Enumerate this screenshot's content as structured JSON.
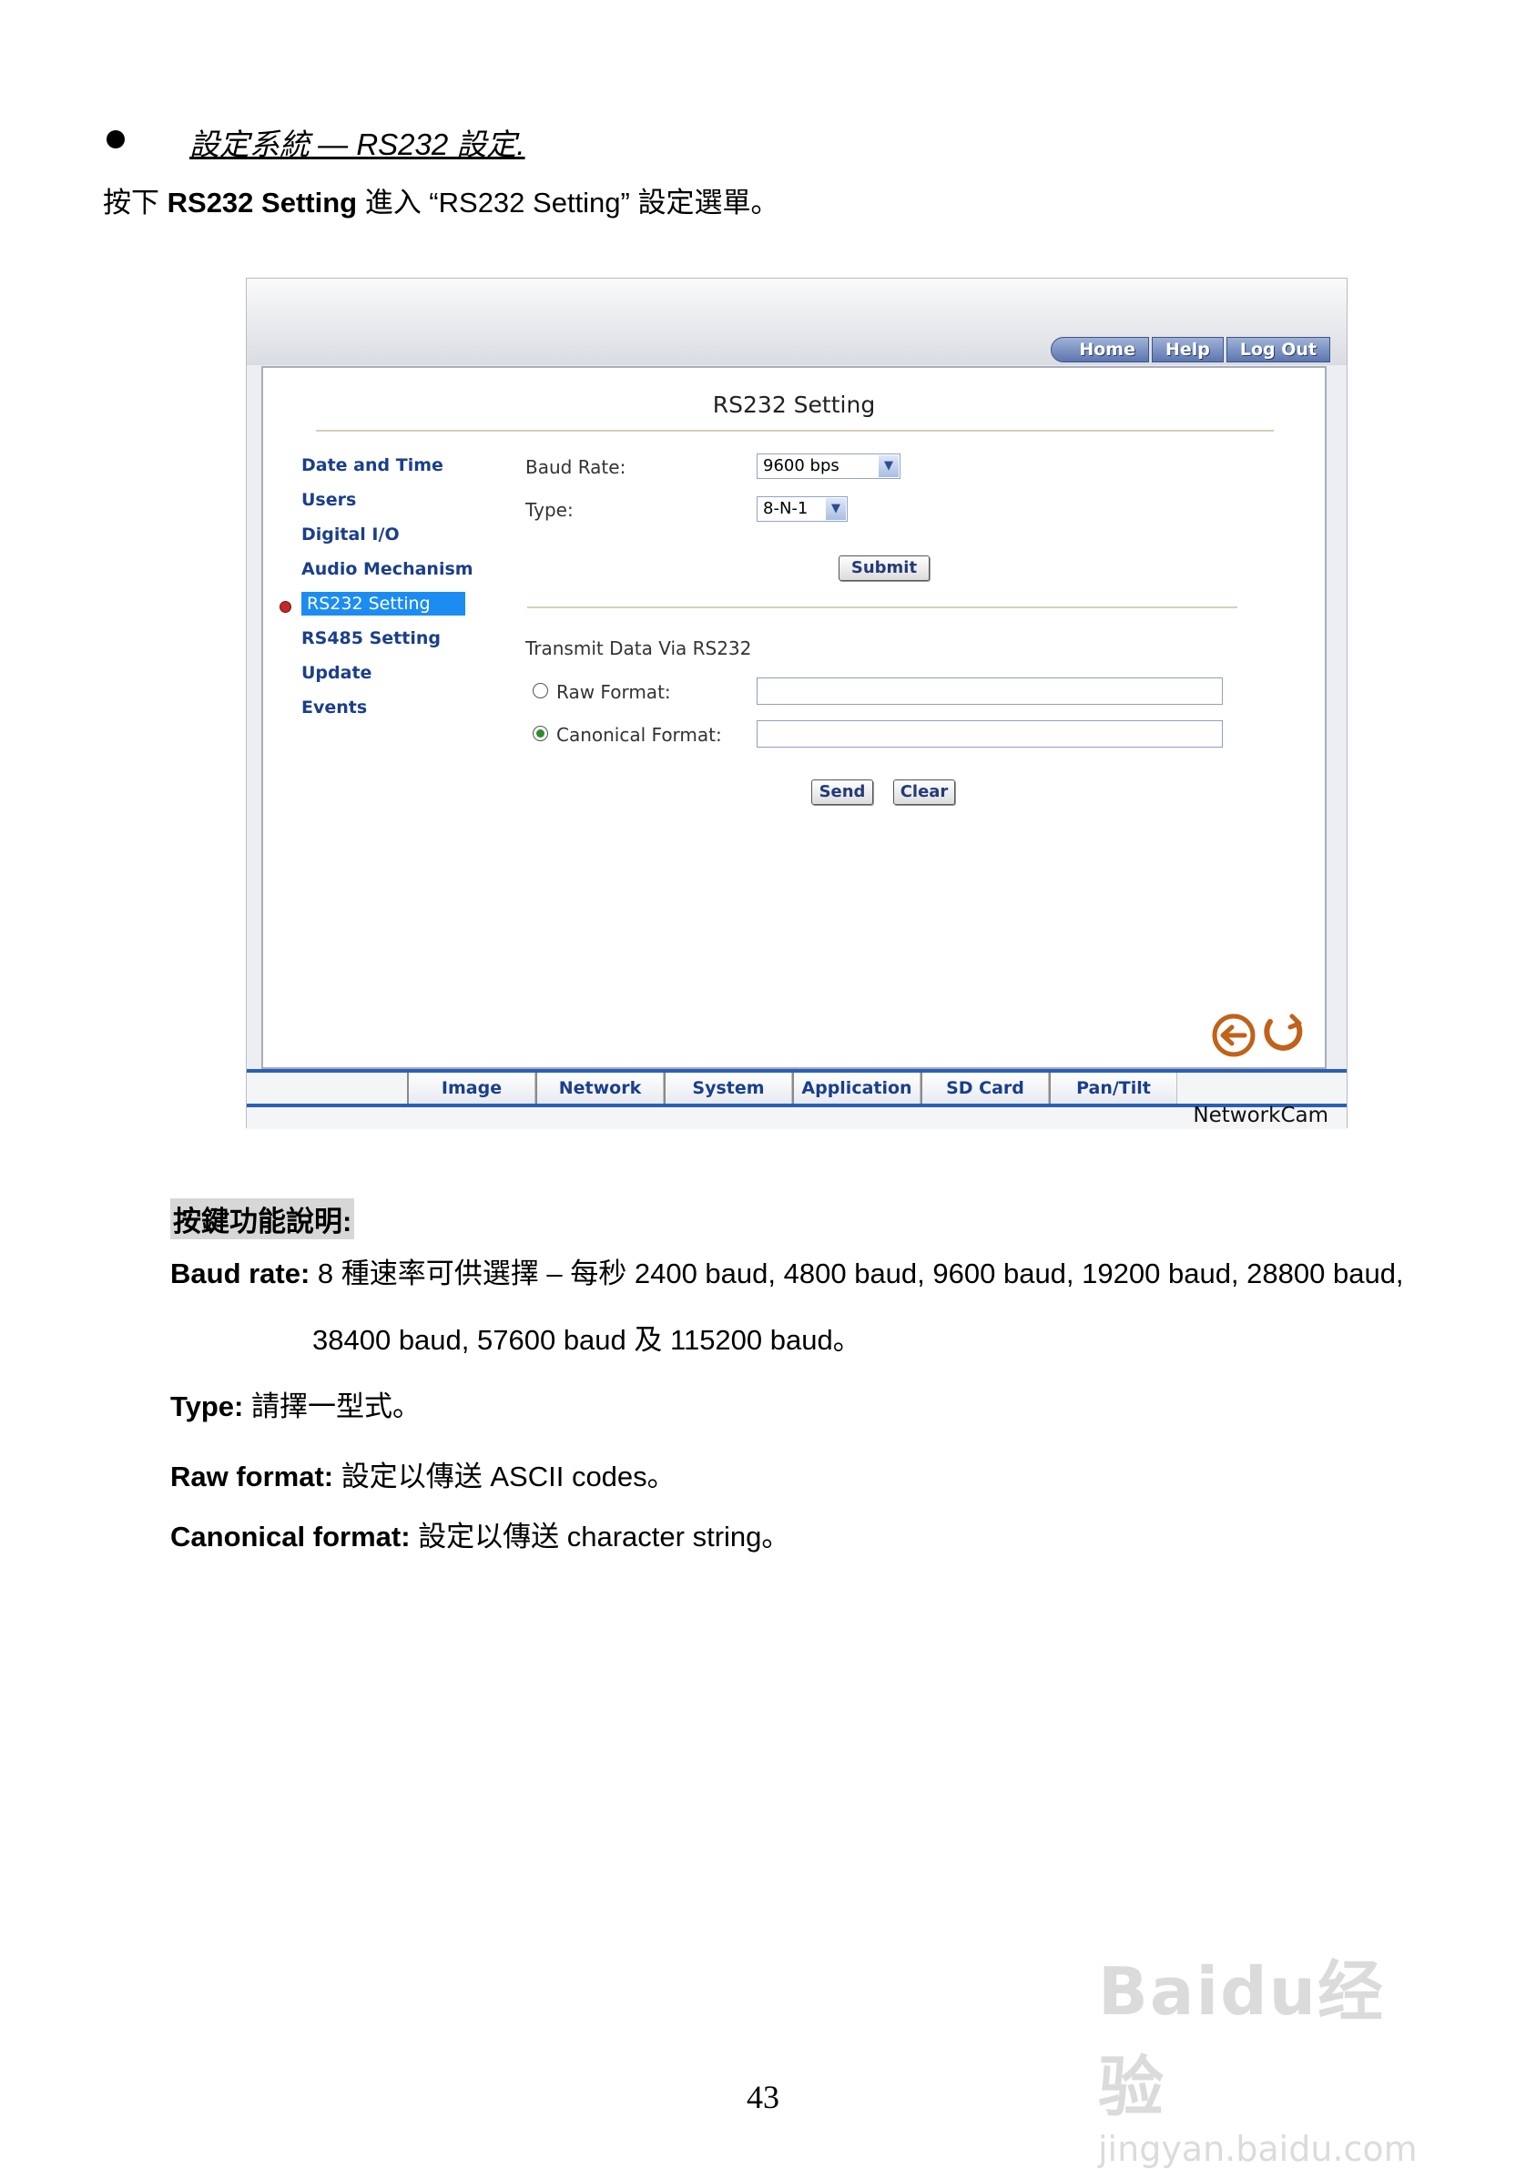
{
  "doc": {
    "heading": "設定系統 — RS232 設定.",
    "intro_pre": "按下 ",
    "intro_bold": "RS232 Setting",
    "intro_post": " 進入 “RS232 Setting” 設定選單。",
    "page_number": "43"
  },
  "screenshot": {
    "topnav": [
      "Home",
      "Help",
      "Log Out"
    ],
    "title": "RS232 Setting",
    "sidebar": [
      {
        "label": "Date and Time",
        "active": false
      },
      {
        "label": "Users",
        "active": false
      },
      {
        "label": "Digital I/O",
        "active": false
      },
      {
        "label": "Audio Mechanism",
        "active": false
      },
      {
        "label": "RS232 Setting",
        "active": true
      },
      {
        "label": "RS485 Setting",
        "active": false
      },
      {
        "label": "Update",
        "active": false
      },
      {
        "label": "Events",
        "active": false
      }
    ],
    "form": {
      "baud_label": "Baud Rate:",
      "baud_value": "9600 bps",
      "type_label": "Type:",
      "type_value": "8-N-1",
      "submit_label": "Submit",
      "transmit_label": "Transmit Data Via RS232",
      "raw_label": "Raw Format:",
      "raw_value": "",
      "canonical_label": "Canonical Format:",
      "canonical_value": "",
      "send_label": "Send",
      "clear_label": "Clear"
    },
    "tabs": [
      "Image",
      "Network",
      "System",
      "Application",
      "SD Card",
      "Pan/Tilt"
    ],
    "brand": "NetworkCam",
    "colors": {
      "accent": "#1c8cf2",
      "nav_text": "#1a3f8a",
      "bar": "#2b5fb8"
    }
  },
  "description": {
    "header": "按鍵功能說明:",
    "baud_term": "Baud rate:",
    "baud_text1": " 8 種速率可供選擇 – 每秒 2400 baud, 4800 baud, 9600 baud, 19200 baud, 28800 baud,",
    "baud_text2": "38400 baud, 57600 baud 及 115200 baud。",
    "type_term": "Type:",
    "type_text": " 請擇一型式。",
    "raw_term": "Raw format:",
    "raw_text": " 設定以傳送 ASCII codes。",
    "canon_term": "Canonical format:",
    "canon_text": " 設定以傳送 character string。"
  },
  "watermark": {
    "brand": "Bai",
    "brand2": "du",
    "brand_cn": "经验",
    "sub": "jingyan.baidu.com"
  }
}
